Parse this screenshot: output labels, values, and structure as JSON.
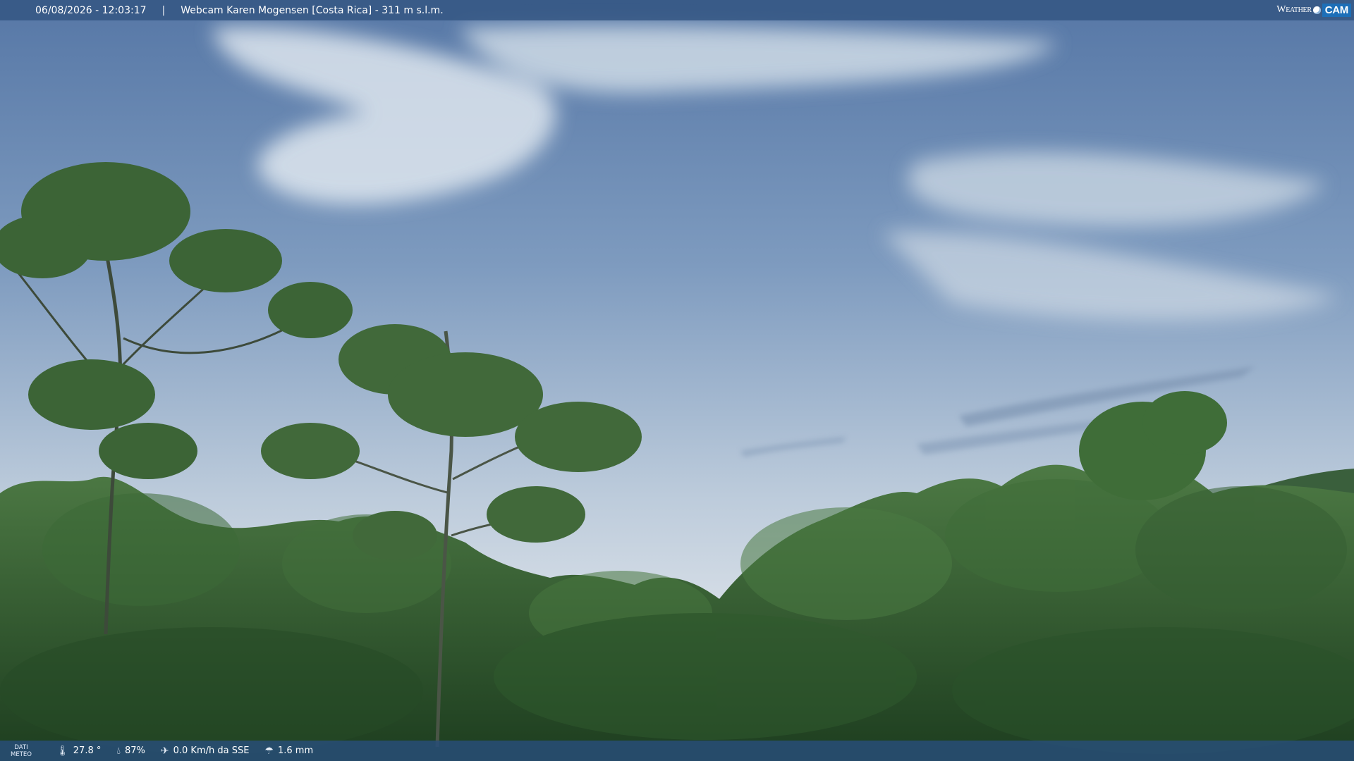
{
  "header": {
    "datetime": "06/08/2026 - 12:03:17",
    "separator": "|",
    "title": "Webcam Karen Mogensen [Costa Rica] - 311 m s.l.m."
  },
  "logo": {
    "weather": "Weather",
    "cam": "CAM"
  },
  "footer": {
    "label_line1": "DATI",
    "label_line2": "METEO",
    "temperature": "27.8 °",
    "humidity": "87%",
    "wind": "0.0 Km/h da SSE",
    "rain": "1.6 mm"
  },
  "icons": {
    "temperature": "thermometer-icon",
    "humidity": "humidity-drop-icon",
    "wind": "wind-icon",
    "rain": "rain-cloud-icon"
  },
  "colors": {
    "sky_top": "#5a7dab",
    "sky_bottom": "#c7d3df",
    "forest": "#2f5a2f",
    "bar": "#345682"
  }
}
